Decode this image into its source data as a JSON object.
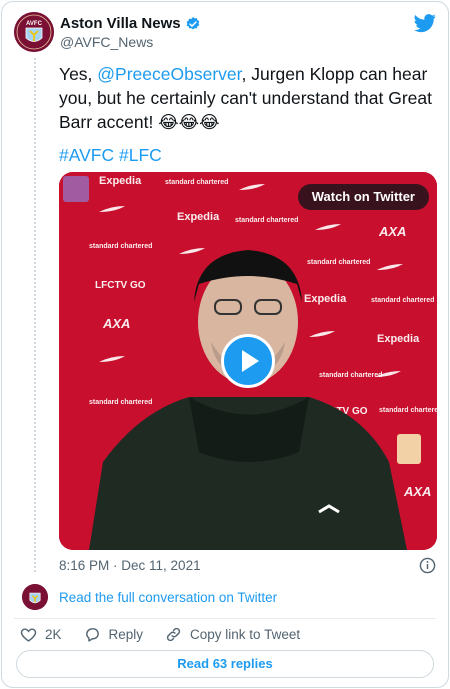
{
  "author": {
    "display_name": "Aston Villa News",
    "handle": "@AVFC_News",
    "avatar_text": "AVFC"
  },
  "tweet": {
    "text_before": "Yes, ",
    "mention": "@PreeceObserver",
    "text_after": ", Jurgen Klopp can hear you, but he certainly can't understand that Great Barr accent! 😂😂😂",
    "hashtags": [
      "#AVFC",
      "#LFC"
    ]
  },
  "media": {
    "watch_label": "Watch on Twitter",
    "backdrop_sponsors": [
      "Expedia",
      "standard chartered",
      "LFCTV GO",
      "AXA"
    ]
  },
  "meta": {
    "timestamp": "8:16 PM · Dec 11, 2021"
  },
  "conversation": {
    "link_label": "Read the full conversation on Twitter"
  },
  "actions": {
    "likes": "2K",
    "reply_label": "Reply",
    "copy_label": "Copy link to Tweet"
  },
  "replies": {
    "button_label": "Read 63 replies"
  },
  "colors": {
    "accent": "#1d9bf0",
    "club_maroon": "#7a1034",
    "backdrop_red": "#c8102e"
  }
}
